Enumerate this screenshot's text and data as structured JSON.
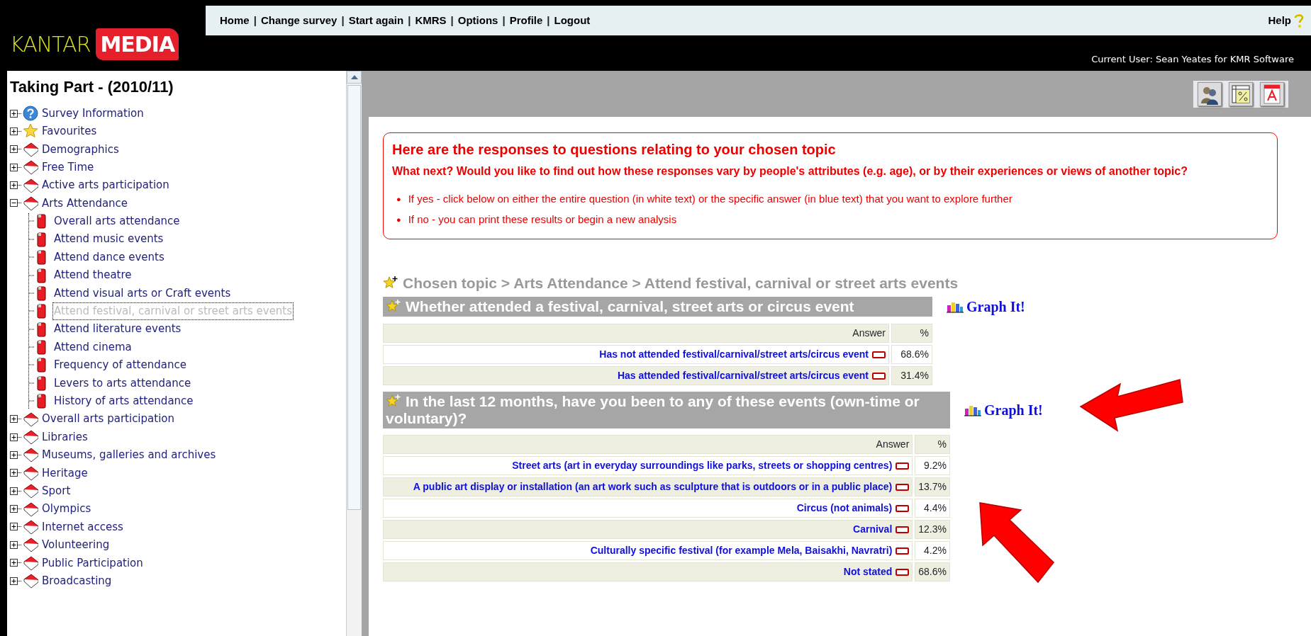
{
  "header": {
    "logo": {
      "word1": "KANTAR",
      "word2": "MEDIA"
    },
    "nav": {
      "separator": "|",
      "links": [
        "Home",
        "Change survey",
        "Start again",
        "KMRS",
        "Options",
        "Profile",
        "Logout"
      ]
    },
    "help": "Help",
    "current_user": "Current User: Sean Yeates for KMR Software"
  },
  "sidebar": {
    "title": "Taking Part - (2010/11)",
    "tree": [
      {
        "label": "Survey Information",
        "kind": "info",
        "expanded": false,
        "selected": false
      },
      {
        "label": "Favourites",
        "kind": "star",
        "expanded": false,
        "selected": false
      },
      {
        "label": "Demographics",
        "kind": "folder",
        "expanded": false,
        "selected": false
      },
      {
        "label": "Free Time",
        "kind": "folder",
        "expanded": false,
        "selected": false
      },
      {
        "label": "Active arts participation",
        "kind": "folder",
        "expanded": false,
        "selected": false
      },
      {
        "label": "Arts Attendance",
        "kind": "folder",
        "expanded": true,
        "selected": false,
        "children": [
          {
            "label": "Overall arts attendance",
            "kind": "topic",
            "selected": false
          },
          {
            "label": "Attend music events",
            "kind": "topic",
            "selected": false
          },
          {
            "label": "Attend dance events",
            "kind": "topic",
            "selected": false
          },
          {
            "label": "Attend theatre",
            "kind": "topic",
            "selected": false
          },
          {
            "label": "Attend visual arts or Craft events",
            "kind": "topic",
            "selected": false
          },
          {
            "label": "Attend festival, carnival or street arts events",
            "kind": "topic",
            "selected": true
          },
          {
            "label": "Attend literature events",
            "kind": "topic",
            "selected": false
          },
          {
            "label": "Attend cinema",
            "kind": "topic",
            "selected": false
          },
          {
            "label": "Frequency of attendance",
            "kind": "topic",
            "selected": false
          },
          {
            "label": "Levers to arts attendance",
            "kind": "topic",
            "selected": false
          },
          {
            "label": "History of arts attendance",
            "kind": "topic",
            "selected": false
          }
        ]
      },
      {
        "label": "Overall arts participation",
        "kind": "folder",
        "expanded": false,
        "selected": false
      },
      {
        "label": "Libraries",
        "kind": "folder",
        "expanded": false,
        "selected": false
      },
      {
        "label": "Museums, galleries and archives",
        "kind": "folder",
        "expanded": false,
        "selected": false
      },
      {
        "label": "Heritage",
        "kind": "folder",
        "expanded": false,
        "selected": false
      },
      {
        "label": "Sport",
        "kind": "folder",
        "expanded": false,
        "selected": false
      },
      {
        "label": "Olympics",
        "kind": "folder",
        "expanded": false,
        "selected": false
      },
      {
        "label": "Internet access",
        "kind": "folder",
        "expanded": false,
        "selected": false
      },
      {
        "label": "Volunteering",
        "kind": "folder",
        "expanded": false,
        "selected": false
      },
      {
        "label": "Public Participation",
        "kind": "folder",
        "expanded": false,
        "selected": false
      },
      {
        "label": "Broadcasting",
        "kind": "folder",
        "expanded": false,
        "selected": false
      }
    ]
  },
  "toolbar": [
    {
      "kind": "people"
    },
    {
      "kind": "percent"
    },
    {
      "kind": "pdf"
    }
  ],
  "notice": {
    "heading": "Here are the responses to questions relating to your chosen topic",
    "question": "What next? Would you like to find out how these responses vary by people's attributes (e.g. age), or by their experiences or views of another topic?",
    "bullet": "●",
    "bullets": [
      "If yes - click below on either the entire question (in white text) or the specific answer (in blue text) that you want to explore further",
      "If no - you can print these results or begin a new analysis"
    ]
  },
  "breadcrumb": "Chosen topic > Arts Attendance > Attend festival, carnival or street arts events",
  "questions": [
    {
      "title": "Whether attended a festival, carnival, street arts or circus event",
      "graph": "Graph It!",
      "columns": [
        "Answer",
        "%"
      ],
      "rows": [
        {
          "answer": "Has not attended festival/carnival/street arts/circus event",
          "pct": "68.6%"
        },
        {
          "answer": "Has attended festival/carnival/street arts/circus event",
          "pct": "31.4%"
        }
      ]
    },
    {
      "title": "In the last 12 months, have you been to any of these events (own-time or voluntary)?",
      "graph": "Graph It!",
      "columns": [
        "Answer",
        "%"
      ],
      "rows": [
        {
          "answer": "Street arts (art in everyday surroundings like parks, streets or shopping centres)",
          "pct": "9.2%"
        },
        {
          "answer": "A public art display or installation (an art work such as sculpture that is outdoors or in a public place)",
          "pct": "13.7%"
        },
        {
          "answer": "Circus (not animals)",
          "pct": "4.4%"
        },
        {
          "answer": "Carnival",
          "pct": "12.3%"
        },
        {
          "answer": "Culturally specific festival (for example Mela, Baisakhi, Navratri)",
          "pct": "4.2%"
        },
        {
          "answer": "Not stated",
          "pct": "68.6%"
        }
      ]
    }
  ]
}
